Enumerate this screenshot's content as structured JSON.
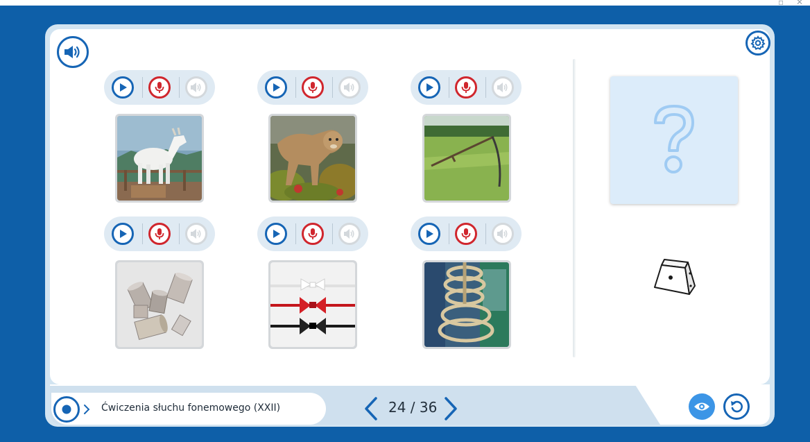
{
  "footer": {
    "title": "Ćwiczenia słuchu fonemowego (XXII)",
    "page_indicator": "24 / 36"
  },
  "icons": {
    "top_left": "speaker-icon",
    "top_right": "settings-gear-icon",
    "card_controls": [
      "play-icon",
      "microphone-icon",
      "speaker-disabled-icon"
    ],
    "footer_left": [
      "record-dot-icon",
      "chevron-right-icon"
    ],
    "pagination": [
      "chevron-left-icon",
      "chevron-right-icon"
    ],
    "footer_right": [
      "eye-icon",
      "reset-icon"
    ],
    "answer_card": "question-mark-icon",
    "dice": "dice-icon"
  },
  "cards": [
    {
      "image": "goat"
    },
    {
      "image": "cougar"
    },
    {
      "image": "scythe"
    },
    {
      "image": "tin-cans"
    },
    {
      "image": "bow-ties"
    },
    {
      "image": "rope-coil"
    }
  ],
  "colors": {
    "frame": "#0e5fa8",
    "accent_blue": "#1665b5",
    "record_red": "#d0262d",
    "disabled_gray": "#d3d8dc",
    "eye_button": "#3c95e6"
  }
}
